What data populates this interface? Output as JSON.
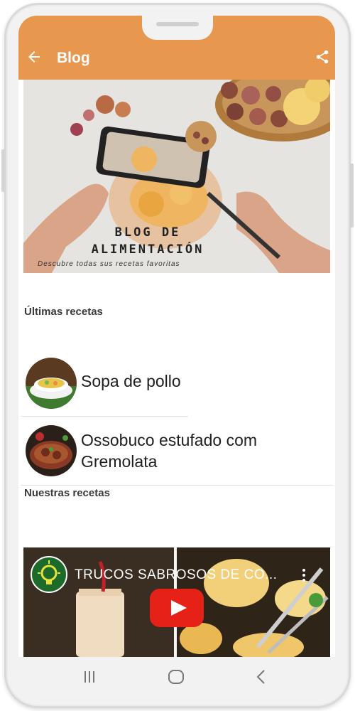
{
  "app_bar": {
    "title": "Blog",
    "back_icon": "arrow-back-icon",
    "share_icon": "share-icon",
    "color": "#e8974e"
  },
  "banner": {
    "title_line1": "BLOG DE",
    "title_line2": "ALIMENTACIÓN",
    "subtitle": "Descubre todas sus recetas favoritas"
  },
  "latest": {
    "heading": "Últimas recetas",
    "items": [
      {
        "name": "Sopa de pollo"
      },
      {
        "name_line1": "Ossobuco estufado com",
        "name_line2": "Gremolata"
      }
    ]
  },
  "ours": {
    "heading": "Nuestras recetas",
    "video_title": "TRUCOS SABROSOS DE CO..."
  },
  "system_nav": {
    "recents_icon": "recents-icon",
    "home_icon": "home-icon",
    "back_icon": "chevron-back-icon"
  }
}
